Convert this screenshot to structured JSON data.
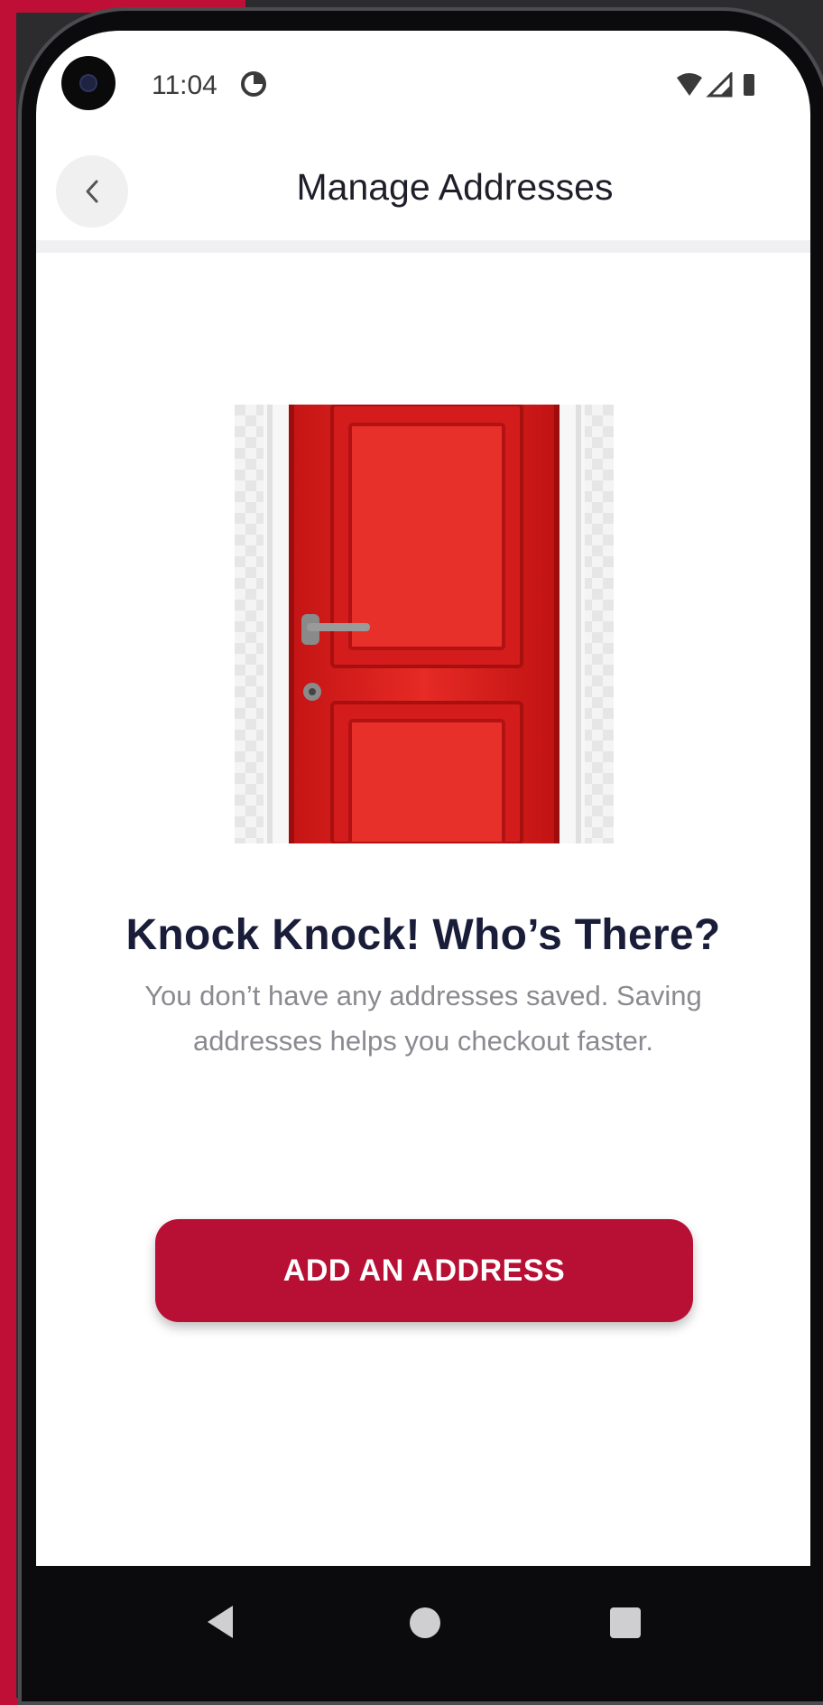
{
  "status_bar": {
    "time": "11:04"
  },
  "header": {
    "title": "Manage Addresses",
    "back_icon": "chevron-left-icon"
  },
  "empty_state": {
    "illustration": "red-door-illustration",
    "title": "Knock Knock! Who’s There?",
    "message": "You don’t have any addresses saved. Saving addresses helps you checkout faster."
  },
  "actions": {
    "add_address_label": "ADD AN ADDRESS"
  },
  "colors": {
    "accent": "#b80f34",
    "title_text": "#1a1d3a",
    "muted_text": "#8a8a90"
  }
}
